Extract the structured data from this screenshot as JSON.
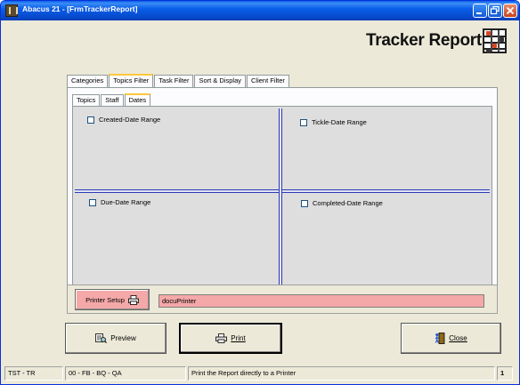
{
  "window": {
    "title": "Abacus 21 - [FrmTrackerReport]",
    "controls": {
      "minimize_icon": "minimize-icon",
      "maximize_icon": "restore-icon",
      "close_icon": "close-icon"
    }
  },
  "header": {
    "title": "Tracker Report",
    "logo_icon": "abacus-icon"
  },
  "outer_tabs": [
    {
      "label": "Categories",
      "active": false
    },
    {
      "label": "Topics Filter",
      "active": true
    },
    {
      "label": "Task Filter",
      "active": false
    },
    {
      "label": "Sort & Display",
      "active": false
    },
    {
      "label": "Client Filter",
      "active": false
    }
  ],
  "inner_tabs": [
    {
      "label": "Topics",
      "active": false
    },
    {
      "label": "Staff",
      "active": false
    },
    {
      "label": "Dates",
      "active": true
    }
  ],
  "date_ranges": {
    "created": {
      "label": "Created-Date Range",
      "checked": false
    },
    "tickle": {
      "label": "Tickle-Date Range",
      "checked": false
    },
    "due": {
      "label": "Due-Date Range",
      "checked": false
    },
    "completed": {
      "label": "Completed-Date Range",
      "checked": false
    }
  },
  "printer": {
    "setup_label": "Printer Setup",
    "setup_icon": "printer-icon",
    "selected_printer": "docuPrinter"
  },
  "actions": {
    "preview_label": "Preview",
    "preview_icon": "preview-icon",
    "print_label": "Print",
    "print_icon": "printer-icon",
    "close_label": "Close",
    "close_icon": "exit-door-icon"
  },
  "statusbar": {
    "cell1": "TST - TR",
    "cell2": "00 - FB - BQ - QA",
    "message": "Print the Report directly to a Printer",
    "page": "1"
  },
  "colors": {
    "titlebar": "#0a5ee8",
    "printer_pink": "#f4a8a8",
    "divider_blue": "#2c3bb8",
    "active_tab_accent": "#ffc83c",
    "panel_gray": "#dedede",
    "window_bg": "#ece9d8"
  }
}
